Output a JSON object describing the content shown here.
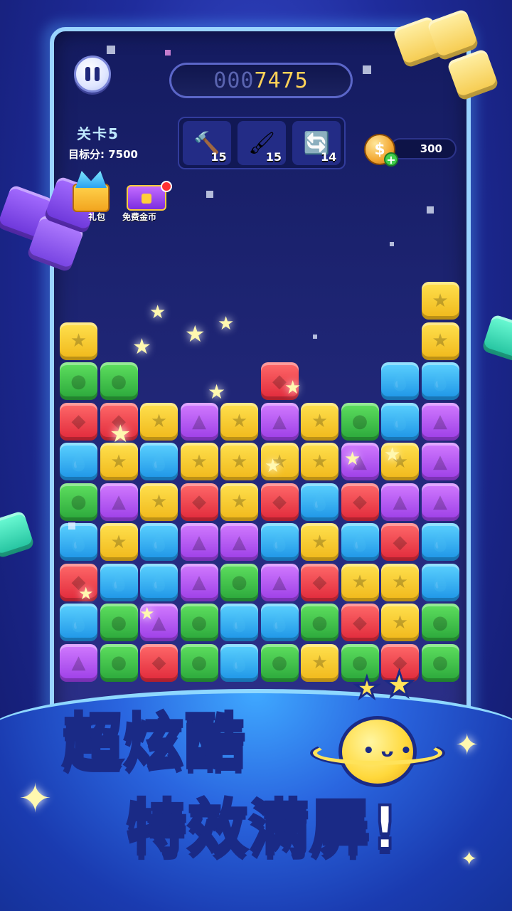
{
  "header": {
    "score_dim": "000",
    "score_lit": "7475",
    "level_title": "关卡5",
    "target_text": "目标分: 7500"
  },
  "tools": [
    {
      "name": "hammer",
      "icon": "🔨",
      "count": "15"
    },
    {
      "name": "paint-brush",
      "icon": "🖌",
      "count": "15"
    },
    {
      "name": "refresh",
      "icon": "🔄",
      "count": "14"
    }
  ],
  "coins": {
    "amount": "300",
    "symbol": "$",
    "plus": "+"
  },
  "side_buttons": {
    "gift_label": "礼包",
    "chest_label": "免费金币"
  },
  "slogan": {
    "line1": "超炫酷",
    "line2": "特效满屏!"
  },
  "colors": {
    "y": "#f0b719",
    "g": "#2aa63a",
    "r": "#e0283a",
    "p": "#9b3de6",
    "b": "#1c93e6"
  },
  "board": {
    "rows": [
      ". . . . . . . . . y",
      "y . . . . . . . . y",
      "g g . . . r . . b b",
      "r r y p y p y g b p",
      "b y b y y y y p y p",
      "g p y r y r b r p p",
      "b y b p p b y b r b",
      "r b b p g p r y y b",
      "b g p g b b g r y g",
      "p g r g b g y g r g"
    ],
    "symbols": {
      "y": "★",
      "g": "●",
      "r": "◆",
      "p": "▲",
      "b": "💧"
    }
  }
}
